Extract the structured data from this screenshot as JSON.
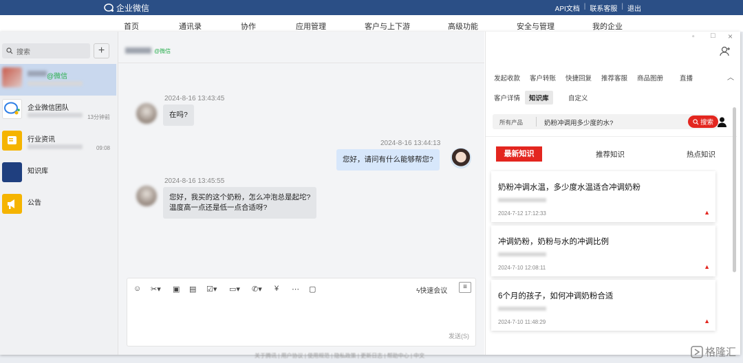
{
  "topbar": {
    "brand": "企业微信",
    "links": [
      "API文档",
      "联系客服",
      "退出"
    ]
  },
  "menu": [
    "首页",
    "通讯录",
    "协作",
    "应用管理",
    "客户与上下游",
    "高级功能",
    "安全与管理",
    "我的企业"
  ],
  "sidebar": {
    "search_placeholder": "搜索",
    "conversations": [
      {
        "name": "@微信",
        "time": ""
      },
      {
        "name": "企业微信团队",
        "time": "13分钟前"
      },
      {
        "name": "行业资讯",
        "time": "09:08"
      },
      {
        "name": "知识库",
        "time": ""
      },
      {
        "name": "公告",
        "time": ""
      }
    ]
  },
  "chat": {
    "contact_tag": "@微信",
    "messages": [
      {
        "time": "2024-8-16 13:43:45",
        "text": "在吗?",
        "from": "customer"
      },
      {
        "time": "2024-8-16 13:44:13",
        "text": "您好，请问有什么能够帮您?",
        "from": "agent"
      },
      {
        "time": "2024-8-16 13:45:55",
        "line1": "您好，我买的这个奶粉，怎么冲泡总是起坨?",
        "line2": "温度高一点还是低一点合适呀?",
        "from": "customer"
      }
    ],
    "quick_meeting": "快速会议",
    "send_label": "发送(S)"
  },
  "panel": {
    "tabs_row1": [
      "发起收款",
      "客户转账",
      "快捷回复",
      "推荐客服",
      "商品图册",
      "直播"
    ],
    "tabs_row2": [
      "客户详情",
      "知识库",
      "自定义"
    ],
    "selected_tab": "知识库",
    "product_filter": "所有产品",
    "query": "奶粉冲调用多少度的水?",
    "search_button": "搜索",
    "sections": [
      "最新知识",
      "推荐知识",
      "热点知识"
    ],
    "articles": [
      {
        "title": "奶粉冲调水温，多少度水温适合冲调奶粉",
        "date": "2024-7-12 17:12:33"
      },
      {
        "title": "冲调奶粉，奶粉与水的冲调比例",
        "date": "2024-7-10 12:08:11"
      },
      {
        "title": "6个月的孩子，如何冲调奶粉合适",
        "date": "2024-7-10 11:48:29"
      }
    ]
  },
  "footer": "关于腾讯  |  用户协议  |  使用规范  |  隐私政策  |  更新日志  |  帮助中心  |  中文",
  "watermark": "格隆汇",
  "colors": {
    "topbar": "#2b4f86",
    "accent_red": "#e3261f",
    "selected_conv": "#c9d8ee",
    "agent_bubble": "#d7e7fb"
  }
}
